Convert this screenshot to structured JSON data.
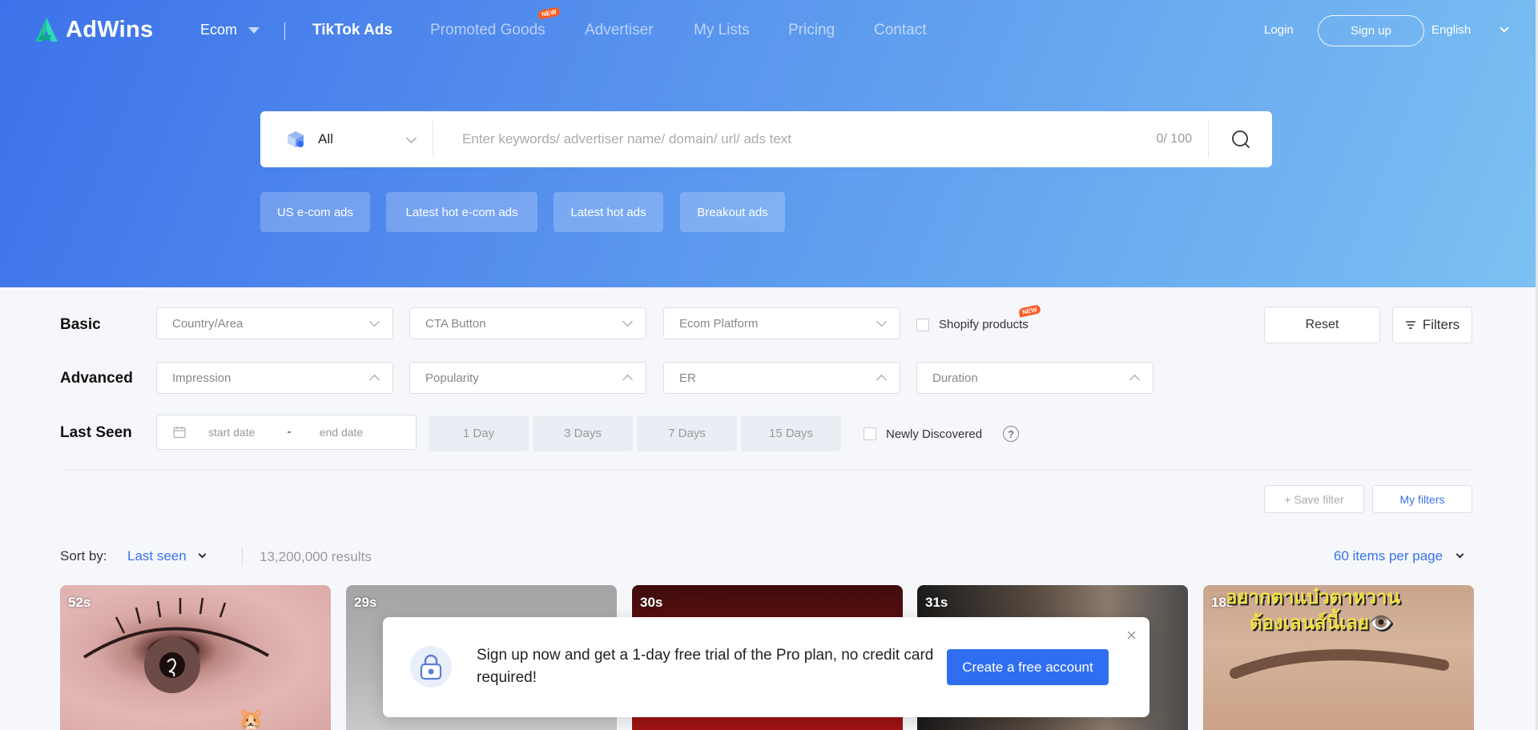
{
  "nav": {
    "logo": "AdWins",
    "ecom_label": "Ecom",
    "links": [
      {
        "label": "TikTok Ads"
      },
      {
        "label": "Promoted Goods",
        "badge": "NEW"
      },
      {
        "label": "Advertiser"
      },
      {
        "label": "My Lists"
      },
      {
        "label": "Pricing"
      },
      {
        "label": "Contact"
      }
    ],
    "login": "Login",
    "signup": "Sign up",
    "language": "English"
  },
  "search": {
    "type": "All",
    "placeholder": "Enter keywords/ advertiser name/ domain/ url/ ads text",
    "counter": "0/ 100"
  },
  "quick_tags": [
    "US e-com ads",
    "Latest hot e-com ads",
    "Latest hot ads",
    "Breakout ads"
  ],
  "filters": {
    "basic_label": "Basic",
    "advanced_label": "Advanced",
    "last_seen_label": "Last Seen",
    "basic": [
      "Country/Area",
      "CTA Button",
      "Ecom Platform"
    ],
    "shopify": "Shopify products",
    "shopify_badge": "NEW",
    "advanced": [
      "Impression",
      "Popularity",
      "ER",
      "Duration"
    ],
    "reset": "Reset",
    "filters_button": "Filters",
    "start_date": "start date",
    "end_date": "end date",
    "date_sep": "-",
    "day_buttons": [
      "1 Day",
      "3 Days",
      "7 Days",
      "15 Days"
    ],
    "newly_discovered": "Newly Discovered",
    "help": "?",
    "save_filter": "+ Save filter",
    "my_filters": "My filters"
  },
  "results": {
    "sort_label": "Sort by:",
    "sort_value": "Last seen",
    "count": "13,200,000 results",
    "per_page": "60 items per page"
  },
  "cards": [
    {
      "duration": "52s"
    },
    {
      "duration": "29s"
    },
    {
      "duration": "30s"
    },
    {
      "duration": "31s"
    },
    {
      "duration": "18s",
      "overlay_line1": "อยากตาแบ๋วตาหวาน",
      "overlay_line2": "ต้องเลนส์นี้เลย👁️"
    }
  ],
  "popup": {
    "text": "Sign up now and get a 1-day free trial of the Pro plan, no credit card required!",
    "cta": "Create a free account",
    "close": "×"
  },
  "colors": {
    "accent": "#3b72e8",
    "badge": "#ff5a1f",
    "cta": "#2f6ef0"
  }
}
